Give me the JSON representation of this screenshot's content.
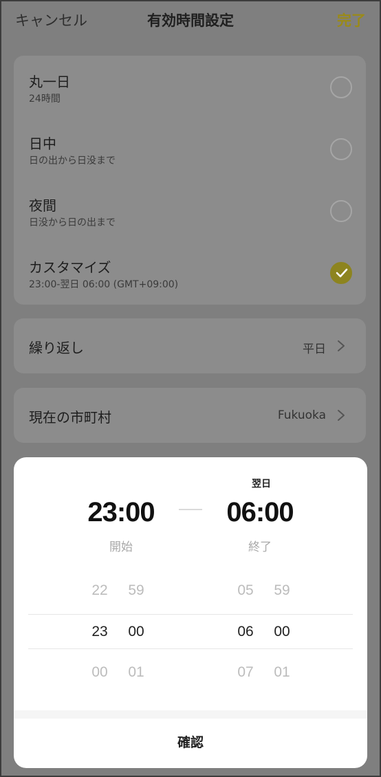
{
  "header": {
    "cancel": "キャンセル",
    "title": "有効時間設定",
    "done": "完了"
  },
  "options": [
    {
      "title": "丸一日",
      "subtitle": "24時間",
      "checked": false
    },
    {
      "title": "日中",
      "subtitle": "日の出から日没まで",
      "checked": false
    },
    {
      "title": "夜間",
      "subtitle": "日没から日の出まで",
      "checked": false
    },
    {
      "title": "カスタマイズ",
      "subtitle": "23:00-翌日 06:00 (GMT+09:00)",
      "checked": true
    }
  ],
  "repeat": {
    "label": "繰り返し",
    "value": "平日"
  },
  "location": {
    "label": "現在の市町村",
    "value": "Fukuoka"
  },
  "picker": {
    "next_day": "翌日",
    "start_time": "23:00",
    "end_time": "06:00",
    "start_label": "開始",
    "end_label": "終了",
    "start_hours": [
      "22",
      "23",
      "00"
    ],
    "start_minutes": [
      "59",
      "00",
      "01"
    ],
    "end_hours": [
      "05",
      "06",
      "07"
    ],
    "end_minutes": [
      "59",
      "00",
      "01"
    ],
    "confirm": "確認"
  },
  "colors": {
    "accent": "#9a8a18",
    "overlay": "#7f7f7f",
    "sheet": "#ffffff"
  }
}
